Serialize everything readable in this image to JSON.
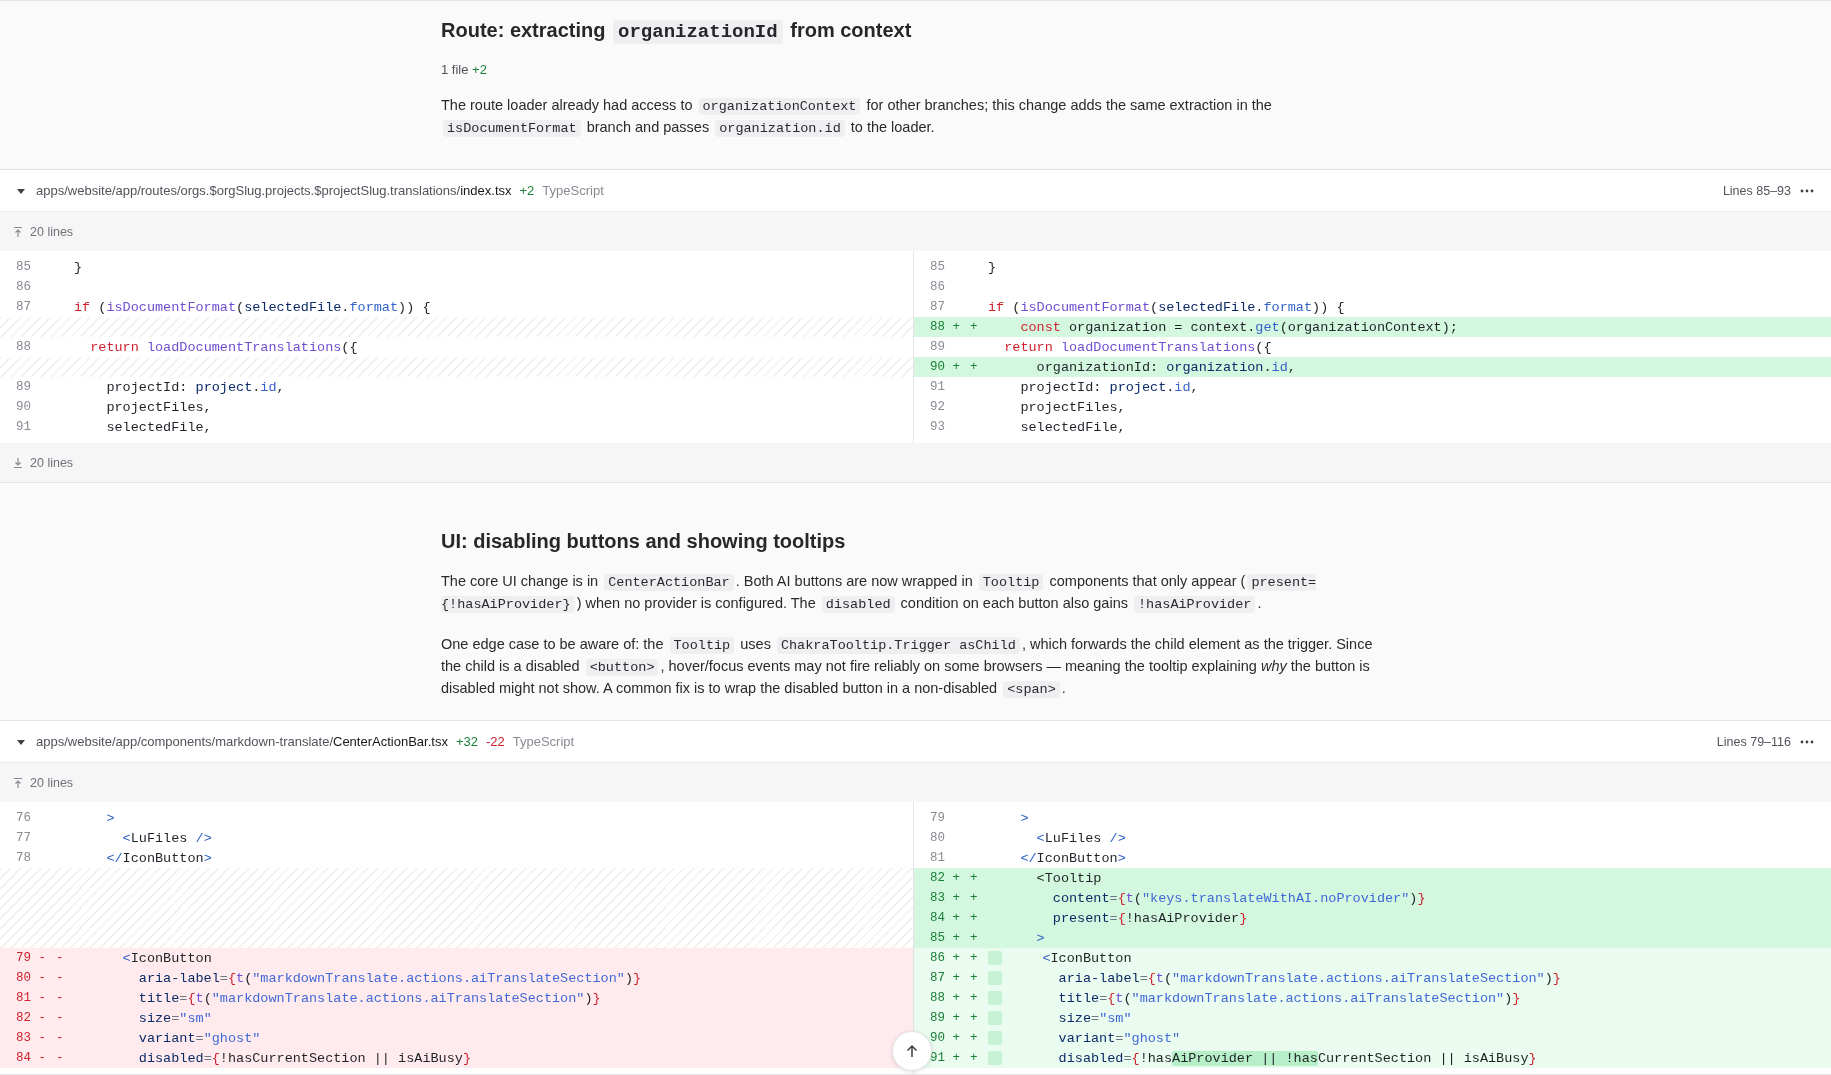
{
  "sections": [
    {
      "title": [
        {
          "kind": "text",
          "text": "Route: extracting "
        },
        {
          "kind": "code",
          "text": "organizationId"
        },
        {
          "kind": "text",
          "text": " from context"
        }
      ],
      "stats": {
        "files": "1 file",
        "additions": "+2"
      },
      "paragraphs": [
        [
          {
            "kind": "text",
            "text": "The route loader already had access to "
          },
          {
            "kind": "code",
            "text": "organizationContext"
          },
          {
            "kind": "text",
            "text": " for other branches; this change adds the same extraction in the "
          },
          {
            "kind": "code",
            "text": "isDocumentFormat"
          },
          {
            "kind": "text",
            "text": " branch and passes "
          },
          {
            "kind": "code",
            "text": "organization.id"
          },
          {
            "kind": "text",
            "text": " to the loader."
          }
        ]
      ],
      "diff": {
        "expanded": true,
        "path": {
          "dir": "apps/website/app/routes/orgs.$orgSlug.projects.$projectSlug.translations/",
          "file": "index.tsx"
        },
        "additions": "+2",
        "language": "TypeScript",
        "lines_label": "Lines 85–93",
        "expand_top": "20 lines",
        "expand_bottom": "20 lines",
        "left": [
          {
            "num": "85",
            "kind": "context",
            "code": [
              {
                "kind": "plain",
                "text": "}"
              }
            ]
          },
          {
            "num": "86",
            "kind": "context"
          },
          {
            "num": "87",
            "kind": "context",
            "code": [
              {
                "kind": "keyword",
                "text": "if"
              },
              {
                "kind": "plain",
                "text": " ("
              },
              {
                "kind": "function",
                "text": "isDocumentFormat"
              },
              {
                "kind": "plain",
                "text": "("
              },
              {
                "kind": "variable",
                "text": "selectedFile"
              },
              {
                "kind": "plain",
                "text": "."
              },
              {
                "kind": "property",
                "text": "format"
              },
              {
                "kind": "plain",
                "text": ")) {"
              }
            ]
          },
          {
            "kind": "spacer"
          },
          {
            "num": "88",
            "kind": "context",
            "code": [
              {
                "kind": "keyword",
                "text": "  return "
              },
              {
                "kind": "function",
                "text": "loadDocumentTranslations"
              },
              {
                "kind": "plain",
                "text": "({"
              }
            ]
          },
          {
            "kind": "spacer"
          },
          {
            "num": "89",
            "kind": "context",
            "code": [
              {
                "kind": "plain",
                "text": "    projectId: "
              },
              {
                "kind": "variable",
                "text": "project"
              },
              {
                "kind": "plain",
                "text": "."
              },
              {
                "kind": "property",
                "text": "id"
              },
              {
                "kind": "plain",
                "text": ","
              }
            ]
          },
          {
            "num": "90",
            "kind": "context",
            "code": [
              {
                "kind": "plain",
                "text": "    projectFiles,"
              }
            ]
          },
          {
            "num": "91",
            "kind": "context",
            "code": [
              {
                "kind": "plain",
                "text": "    selectedFile,"
              }
            ]
          }
        ],
        "right": [
          {
            "num": "85",
            "kind": "context",
            "code": [
              {
                "kind": "plain",
                "text": "}"
              }
            ]
          },
          {
            "num": "86",
            "kind": "context"
          },
          {
            "num": "87",
            "kind": "context",
            "code": [
              {
                "kind": "keyword",
                "text": "if"
              },
              {
                "kind": "plain",
                "text": " ("
              },
              {
                "kind": "function",
                "text": "isDocumentFormat"
              },
              {
                "kind": "plain",
                "text": "("
              },
              {
                "kind": "variable",
                "text": "selectedFile"
              },
              {
                "kind": "plain",
                "text": "."
              },
              {
                "kind": "property",
                "text": "format"
              },
              {
                "kind": "plain",
                "text": ")) {"
              }
            ]
          },
          {
            "num": "88 +",
            "sign": "+",
            "kind": "add",
            "code": [
              {
                "kind": "keyword",
                "text": "    const"
              },
              {
                "kind": "plain",
                "text": " organization = context."
              },
              {
                "kind": "property",
                "text": "get"
              },
              {
                "kind": "plain",
                "text": "(organizationContext);"
              }
            ]
          },
          {
            "num": "89",
            "kind": "context",
            "code": [
              {
                "kind": "keyword",
                "text": "  return "
              },
              {
                "kind": "function",
                "text": "loadDocumentTranslations"
              },
              {
                "kind": "plain",
                "text": "({"
              }
            ]
          },
          {
            "num": "90 +",
            "sign": "+",
            "kind": "add",
            "code": [
              {
                "kind": "plain",
                "text": "      organizationId: "
              },
              {
                "kind": "variable",
                "text": "organization"
              },
              {
                "kind": "plain",
                "text": "."
              },
              {
                "kind": "property",
                "text": "id"
              },
              {
                "kind": "plain",
                "text": ","
              }
            ]
          },
          {
            "num": "91",
            "kind": "context",
            "code": [
              {
                "kind": "plain",
                "text": "    projectId: "
              },
              {
                "kind": "variable",
                "text": "project"
              },
              {
                "kind": "plain",
                "text": "."
              },
              {
                "kind": "property",
                "text": "id"
              },
              {
                "kind": "plain",
                "text": ","
              }
            ]
          },
          {
            "num": "92",
            "kind": "context",
            "code": [
              {
                "kind": "plain",
                "text": "    projectFiles,"
              }
            ]
          },
          {
            "num": "93",
            "kind": "context",
            "code": [
              {
                "kind": "plain",
                "text": "    selectedFile,"
              }
            ]
          }
        ]
      }
    },
    {
      "title": [
        {
          "kind": "text",
          "text": "UI: disabling buttons and showing tooltips"
        }
      ],
      "paragraphs": [
        [
          {
            "kind": "text",
            "text": "The core UI change is in "
          },
          {
            "kind": "code",
            "text": "CenterActionBar"
          },
          {
            "kind": "text",
            "text": ". Both AI buttons are now wrapped in "
          },
          {
            "kind": "code",
            "text": "Tooltip"
          },
          {
            "kind": "text",
            "text": " components that only appear ("
          },
          {
            "kind": "code",
            "text": "present={!hasAiProvider}"
          },
          {
            "kind": "text",
            "text": ") when no provider is configured. The "
          },
          {
            "kind": "code",
            "text": "disabled"
          },
          {
            "kind": "text",
            "text": " condition on each button also gains "
          },
          {
            "kind": "code",
            "text": "!hasAiProvider"
          },
          {
            "kind": "text",
            "text": "."
          }
        ],
        [
          {
            "kind": "text",
            "text": "One edge case to be aware of: the "
          },
          {
            "kind": "code",
            "text": "Tooltip"
          },
          {
            "kind": "text",
            "text": " uses "
          },
          {
            "kind": "code",
            "text": "ChakraTooltip.Trigger asChild"
          },
          {
            "kind": "text",
            "text": ", which forwards the child element as the trigger. Since the child is a disabled "
          },
          {
            "kind": "code",
            "text": "<button>"
          },
          {
            "kind": "text",
            "text": ", hover/focus events may not fire reliably on some browsers — meaning the tooltip explaining *why* the button is disabled might not show. A common fix is to wrap the disabled button in a non-disabled "
          },
          {
            "kind": "code",
            "text": "<span>"
          },
          {
            "kind": "text",
            "text": "."
          }
        ]
      ],
      "diff": {
        "expanded": true,
        "path": {
          "dir": "apps/website/app/components/markdown-translate/",
          "file": "CenterActionBar.tsx"
        },
        "additions": "+32",
        "deletions": "-22",
        "language": "TypeScript",
        "lines_label": "Lines 79–116",
        "expand_top": "20 lines",
        "left": [
          {
            "num": "76",
            "kind": "context",
            "code": [
              {
                "kind": "tag",
                "text": "    >"
              }
            ]
          },
          {
            "num": "77",
            "kind": "context",
            "code": [
              {
                "kind": "tag",
                "text": "      <"
              },
              {
                "kind": "plain",
                "text": "LuFiles "
              },
              {
                "kind": "tag",
                "text": "/>"
              }
            ]
          },
          {
            "num": "78",
            "kind": "context",
            "code": [
              {
                "kind": "tag",
                "text": "    </"
              },
              {
                "kind": "plain",
                "text": "IconButton"
              },
              {
                "kind": "tag",
                "text": ">"
              }
            ]
          },
          {
            "kind": "spacer"
          },
          {
            "kind": "spacer"
          },
          {
            "kind": "spacer"
          },
          {
            "kind": "spacer"
          },
          {
            "num": "79 -",
            "sign": "-",
            "kind": "remove",
            "code": [
              {
                "kind": "tag",
                "text": "      <"
              },
              {
                "kind": "plain",
                "text": "IconButton"
              }
            ]
          },
          {
            "num": "80 -",
            "sign": "-",
            "kind": "remove",
            "code": [
              {
                "kind": "variable",
                "text": "        aria-label"
              },
              {
                "kind": "operator",
                "text": "="
              },
              {
                "kind": "brace",
                "text": "{"
              },
              {
                "kind": "function",
                "text": "t"
              },
              {
                "kind": "plain",
                "text": "("
              },
              {
                "kind": "string",
                "text": "\"markdownTranslate.actions.aiTranslateSection\""
              },
              {
                "kind": "plain",
                "text": ")"
              },
              {
                "kind": "brace",
                "text": "}"
              }
            ]
          },
          {
            "num": "81 -",
            "sign": "-",
            "kind": "remove",
            "code": [
              {
                "kind": "variable",
                "text": "        title"
              },
              {
                "kind": "operator",
                "text": "="
              },
              {
                "kind": "brace",
                "text": "{"
              },
              {
                "kind": "function",
                "text": "t"
              },
              {
                "kind": "plain",
                "text": "("
              },
              {
                "kind": "string",
                "text": "\"markdownTranslate.actions.aiTranslateSection\""
              },
              {
                "kind": "plain",
                "text": ")"
              },
              {
                "kind": "brace",
                "text": "}"
              }
            ]
          },
          {
            "num": "82 -",
            "sign": "-",
            "kind": "remove",
            "code": [
              {
                "kind": "variable",
                "text": "        size"
              },
              {
                "kind": "operator",
                "text": "="
              },
              {
                "kind": "string",
                "text": "\"sm\""
              }
            ]
          },
          {
            "num": "83 -",
            "sign": "-",
            "kind": "remove",
            "code": [
              {
                "kind": "variable",
                "text": "        variant"
              },
              {
                "kind": "operator",
                "text": "="
              },
              {
                "kind": "string",
                "text": "\"ghost\""
              }
            ]
          },
          {
            "num": "84 -",
            "sign": "-",
            "kind": "remove",
            "code": [
              {
                "kind": "variable",
                "text": "        disabled"
              },
              {
                "kind": "operator",
                "text": "="
              },
              {
                "kind": "brace",
                "text": "{"
              },
              {
                "kind": "plain",
                "text": "!hasCurrentSection || isAiBusy"
              },
              {
                "kind": "brace",
                "text": "}"
              }
            ]
          }
        ],
        "right": [
          {
            "num": "79",
            "kind": "context",
            "code": [
              {
                "kind": "tag",
                "text": "    >"
              }
            ]
          },
          {
            "num": "80",
            "kind": "context",
            "code": [
              {
                "kind": "tag",
                "text": "      <"
              },
              {
                "kind": "plain",
                "text": "LuFiles "
              },
              {
                "kind": "tag",
                "text": "/>"
              }
            ]
          },
          {
            "num": "81",
            "kind": "context",
            "code": [
              {
                "kind": "tag",
                "text": "    </"
              },
              {
                "kind": "plain",
                "text": "IconButton"
              },
              {
                "kind": "tag",
                "text": ">"
              }
            ]
          },
          {
            "num": "82 +",
            "sign": "+",
            "kind": "add",
            "code": [
              {
                "kind": "plain",
                "text": "      <Tooltip"
              }
            ]
          },
          {
            "num": "83 +",
            "sign": "+",
            "kind": "add",
            "code": [
              {
                "kind": "variable",
                "text": "        content"
              },
              {
                "kind": "operator",
                "text": "="
              },
              {
                "kind": "brace",
                "text": "{"
              },
              {
                "kind": "function",
                "text": "t"
              },
              {
                "kind": "plain",
                "text": "("
              },
              {
                "kind": "string",
                "text": "\"keys.translateWithAI.noProvider\""
              },
              {
                "kind": "plain",
                "text": ")"
              },
              {
                "kind": "brace",
                "text": "}"
              }
            ]
          },
          {
            "num": "84 +",
            "sign": "+",
            "kind": "add",
            "code": [
              {
                "kind": "variable",
                "text": "        present"
              },
              {
                "kind": "operator",
                "text": "="
              },
              {
                "kind": "brace",
                "text": "{"
              },
              {
                "kind": "plain",
                "text": "!hasAiProvider"
              },
              {
                "kind": "brace",
                "text": "}"
              }
            ]
          },
          {
            "num": "85 +",
            "sign": "+",
            "kind": "add",
            "code": [
              {
                "kind": "tag",
                "text": "      >"
              }
            ]
          },
          {
            "num": "86 +",
            "sign": "+",
            "kind": "moved",
            "code": [
              {
                "kind": "tag",
                "text": "    <"
              },
              {
                "kind": "plain",
                "text": "IconButton"
              }
            ]
          },
          {
            "num": "87 +",
            "sign": "+",
            "kind": "moved",
            "code": [
              {
                "kind": "variable",
                "text": "      aria-label"
              },
              {
                "kind": "operator",
                "text": "="
              },
              {
                "kind": "brace",
                "text": "{"
              },
              {
                "kind": "function",
                "text": "t"
              },
              {
                "kind": "plain",
                "text": "("
              },
              {
                "kind": "string",
                "text": "\"markdownTranslate.actions.aiTranslateSection\""
              },
              {
                "kind": "plain",
                "text": ")"
              },
              {
                "kind": "brace",
                "text": "}"
              }
            ]
          },
          {
            "num": "88 +",
            "sign": "+",
            "kind": "moved",
            "code": [
              {
                "kind": "variable",
                "text": "      title"
              },
              {
                "kind": "operator",
                "text": "="
              },
              {
                "kind": "brace",
                "text": "{"
              },
              {
                "kind": "function",
                "text": "t"
              },
              {
                "kind": "plain",
                "text": "("
              },
              {
                "kind": "string",
                "text": "\"markdownTranslate.actions.aiTranslateSection\""
              },
              {
                "kind": "plain",
                "text": ")"
              },
              {
                "kind": "brace",
                "text": "}"
              }
            ]
          },
          {
            "num": "89 +",
            "sign": "+",
            "kind": "moved",
            "code": [
              {
                "kind": "variable",
                "text": "      size"
              },
              {
                "kind": "operator",
                "text": "="
              },
              {
                "kind": "string",
                "text": "\"sm\""
              }
            ]
          },
          {
            "num": "90 +",
            "sign": "+",
            "kind": "moved",
            "code": [
              {
                "kind": "variable",
                "text": "      variant"
              },
              {
                "kind": "operator",
                "text": "="
              },
              {
                "kind": "string",
                "text": "\"ghost\""
              }
            ]
          },
          {
            "num": "91 +",
            "sign": "+",
            "kind": "moved",
            "code": [
              {
                "kind": "variable",
                "text": "      disabled"
              },
              {
                "kind": "operator",
                "text": "="
              },
              {
                "kind": "brace",
                "text": "{"
              },
              {
                "kind": "plain",
                "text": "!has"
              },
              {
                "kind": "highlight",
                "text": "AiProvider || !has"
              },
              {
                "kind": "plain",
                "text": "CurrentSection || isAiBusy"
              },
              {
                "kind": "brace",
                "text": "}"
              }
            ]
          }
        ]
      }
    }
  ]
}
